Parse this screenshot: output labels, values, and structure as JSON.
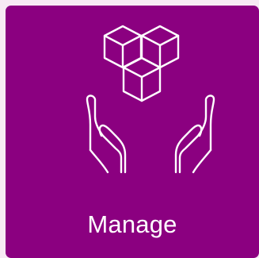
{
  "tile": {
    "label": "Manage",
    "icon": "hands-holding-cubes-icon",
    "background_color": "#8b0080",
    "foreground_color": "#ffffff"
  },
  "page": {
    "background_color": "#f7eaf4"
  }
}
